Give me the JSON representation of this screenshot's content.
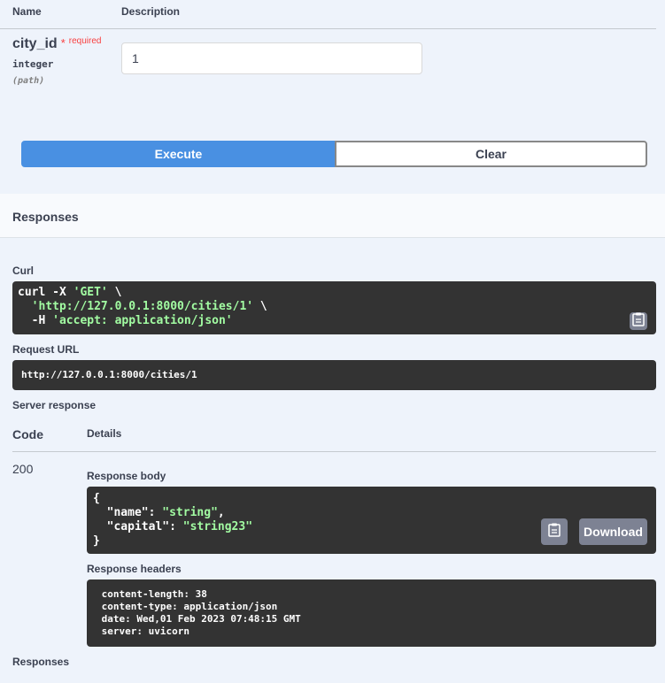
{
  "parameters": {
    "col_name": "Name",
    "col_description": "Description",
    "param": {
      "name": "city_id",
      "required_star": "*",
      "required_label": "required",
      "type": "integer",
      "location": "(path)",
      "value": "1"
    }
  },
  "actions": {
    "execute_label": "Execute",
    "clear_label": "Clear"
  },
  "responses_title": "Responses",
  "curl": {
    "label": "Curl",
    "line1_pre": "curl -X ",
    "line1_str": "'GET'",
    "line1_post": " \\",
    "line2_pre": "  ",
    "line2_str": "'http://127.0.0.1:8000/cities/1'",
    "line2_post": " \\",
    "line3_pre": "  -H ",
    "line3_str": "'accept: application/json'"
  },
  "request_url": {
    "label": "Request URL",
    "value": "http://127.0.0.1:8000/cities/1"
  },
  "server_response": {
    "label": "Server response",
    "col_code": "Code",
    "col_details": "Details",
    "code": "200",
    "body_label": "Response body",
    "body_open": "{",
    "body_k1": "  \"name\": ",
    "body_v1": "\"string\"",
    "body_c1": ",",
    "body_k2": "  \"capital\": ",
    "body_v2": "\"string23\"",
    "body_close": "}",
    "download_label": "Download",
    "headers_label": "Response headers",
    "headers": [
      " content-length: 38",
      " content-type: application/json",
      " date: Wed,01 Feb 2023 07:48:15 GMT",
      " server: uvicorn"
    ]
  },
  "footer_title": "Responses",
  "icons": {
    "copy": "clipboard-icon"
  }
}
